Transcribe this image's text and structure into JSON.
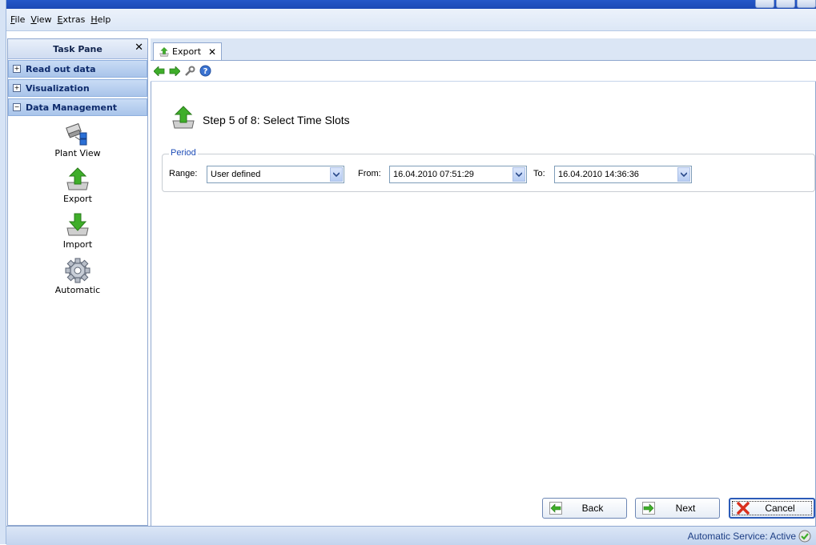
{
  "menu": [
    "File",
    "View",
    "Extras",
    "Help"
  ],
  "taskpane": {
    "title": "Task Pane",
    "sections": [
      {
        "label": "Read out data",
        "expanded": false
      },
      {
        "label": "Visualization",
        "expanded": false
      },
      {
        "label": "Data Management",
        "expanded": true
      }
    ],
    "items": [
      {
        "label": "Plant View",
        "icon": "plant-view-icon"
      },
      {
        "label": "Export",
        "icon": "export-icon"
      },
      {
        "label": "Import",
        "icon": "import-icon"
      },
      {
        "label": "Automatic",
        "icon": "gear-icon"
      }
    ]
  },
  "tab": {
    "label": "Export"
  },
  "step": {
    "title": "Step 5 of 8: Select Time Slots"
  },
  "period": {
    "legend": "Period",
    "range_label": "Range:",
    "range_value": "User defined",
    "from_label": "From:",
    "from_value": "16.04.2010 07:51:29",
    "to_label": "To:",
    "to_value": "16.04.2010 14:36:36"
  },
  "buttons": {
    "back": "Back",
    "next": "Next",
    "cancel": "Cancel"
  },
  "status": {
    "text": "Automatic Service: Active"
  },
  "colors": {
    "accent": "#1e4db7",
    "arrow_green": "#3fae2a",
    "cancel_red": "#d9301e"
  }
}
